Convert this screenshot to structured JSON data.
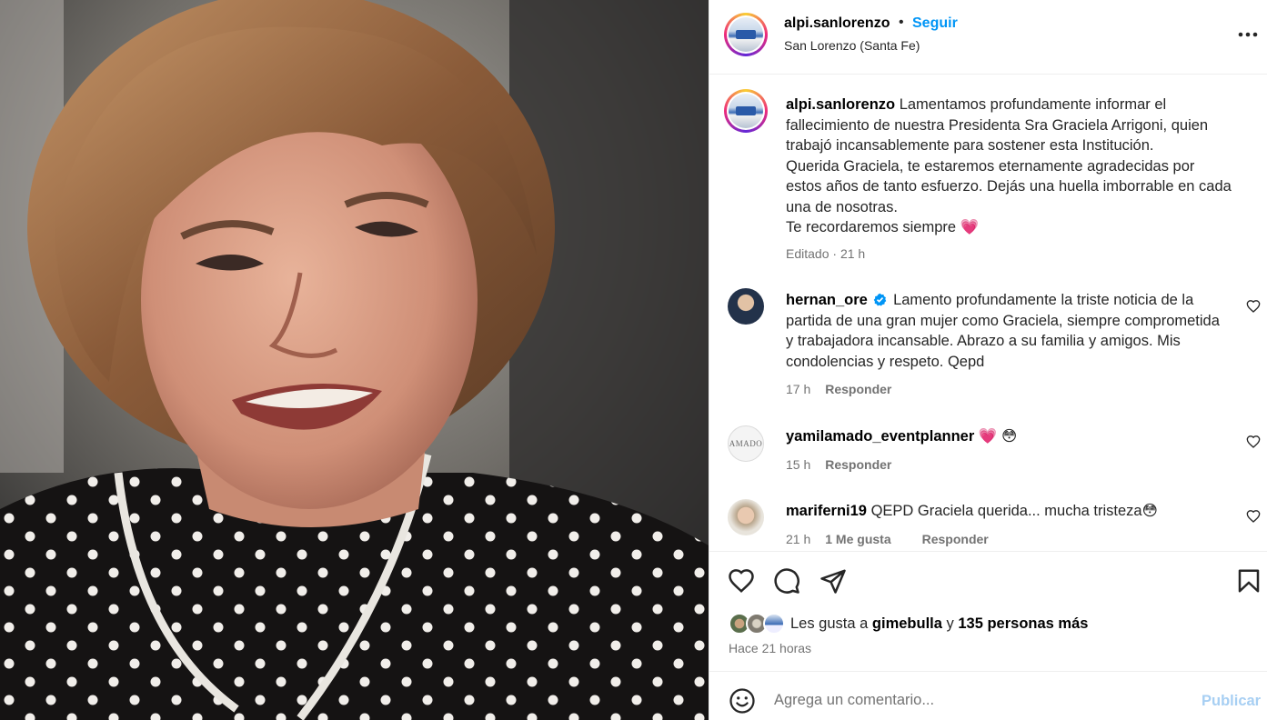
{
  "post": {
    "username": "alpi.sanlorenzo",
    "follow_label": "Seguir",
    "dot": "•",
    "location": "San Lorenzo (Santa Fe)"
  },
  "caption": {
    "username": "alpi.sanlorenzo",
    "line1": "Lamentamos profundamente informar el fallecimiento de nuestra Presidenta Sra Graciela Arrigoni, quien trabajó incansablemente para sostener esta Institución.",
    "line2": "Querida Graciela, te estaremos eternamente agradecidas por estos años de tanto esfuerzo. Dejás una huella imborrable en cada una de nosotras.",
    "line3": "Te recordaremos siempre 💗",
    "edited": "Editado",
    "time": "21 h"
  },
  "comments": [
    {
      "username": "hernan_ore",
      "verified": true,
      "text": "Lamento profundamente la triste noticia de la partida de una gran mujer como Graciela, siempre comprometida y trabajadora incansable. Abrazo a su familia y amigos. Mis condolencias y respeto. Qepd",
      "time": "17 h",
      "reply": "Responder"
    },
    {
      "username": "yamilamado_eventplanner",
      "text": "💗 😳",
      "time": "15 h",
      "reply": "Responder",
      "avatar_text": "AMADO"
    },
    {
      "username": "mariferni19",
      "text": "QEPD Graciela querida... mucha tristeza😳",
      "time": "21 h",
      "likes": "1 Me gusta",
      "reply": "Responder"
    }
  ],
  "likes": {
    "prefix": "Les gusta a",
    "user": "gimebulla",
    "connector": "y",
    "others": "135 personas más"
  },
  "time_ago": "Hace 21 horas",
  "compose": {
    "placeholder": "Agrega un comentario...",
    "publish": "Publicar"
  },
  "colors": {
    "accent": "#0095f6",
    "muted": "#737373",
    "publish_disabled": "#a7cff3"
  }
}
